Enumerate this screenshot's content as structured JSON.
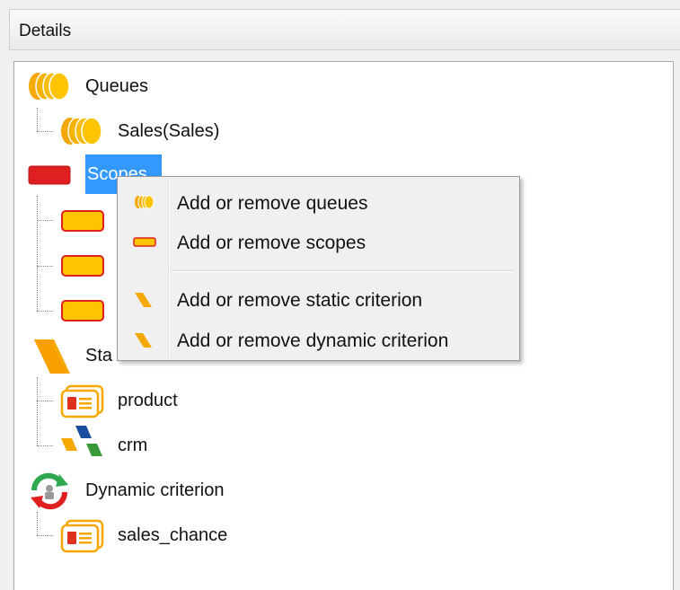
{
  "panel": {
    "title": "Details"
  },
  "tree": {
    "queues_label": "Queues",
    "queue_child_label": "Sales(Sales)",
    "scopes_label": "Scopes",
    "static_label": "Sta",
    "static_children": [
      "product",
      "crm"
    ],
    "dynamic_label": "Dynamic criterion",
    "dynamic_children": [
      "sales_chance"
    ]
  },
  "context_menu": {
    "items": [
      {
        "label": "Add or remove queues",
        "icon": "queues-icon"
      },
      {
        "label": "Add or remove scopes",
        "icon": "scope-icon"
      },
      {
        "label": "Add or remove static criterion",
        "icon": "criterion-icon"
      },
      {
        "label": "Add or remove dynamic criterion",
        "icon": "criterion-icon"
      }
    ]
  },
  "colors": {
    "selection": "#3399ff",
    "queue_orange": "#f5a800",
    "scope_red": "#e02020",
    "scope_yellow": "#ffc400"
  }
}
